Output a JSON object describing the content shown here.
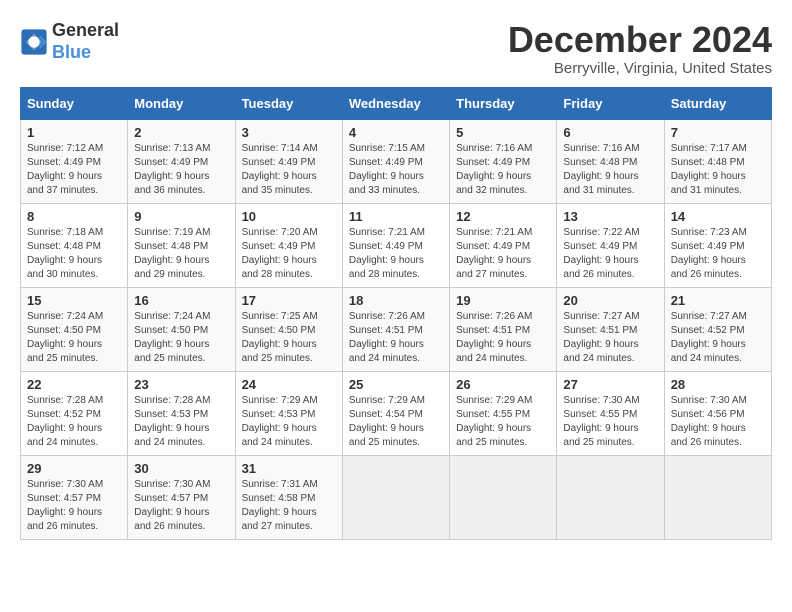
{
  "logo": {
    "text_general": "General",
    "text_blue": "Blue"
  },
  "title": "December 2024",
  "subtitle": "Berryville, Virginia, United States",
  "days_header": [
    "Sunday",
    "Monday",
    "Tuesday",
    "Wednesday",
    "Thursday",
    "Friday",
    "Saturday"
  ],
  "weeks": [
    [
      {
        "day": "1",
        "sunrise": "Sunrise: 7:12 AM",
        "sunset": "Sunset: 4:49 PM",
        "daylight": "Daylight: 9 hours and 37 minutes."
      },
      {
        "day": "2",
        "sunrise": "Sunrise: 7:13 AM",
        "sunset": "Sunset: 4:49 PM",
        "daylight": "Daylight: 9 hours and 36 minutes."
      },
      {
        "day": "3",
        "sunrise": "Sunrise: 7:14 AM",
        "sunset": "Sunset: 4:49 PM",
        "daylight": "Daylight: 9 hours and 35 minutes."
      },
      {
        "day": "4",
        "sunrise": "Sunrise: 7:15 AM",
        "sunset": "Sunset: 4:49 PM",
        "daylight": "Daylight: 9 hours and 33 minutes."
      },
      {
        "day": "5",
        "sunrise": "Sunrise: 7:16 AM",
        "sunset": "Sunset: 4:49 PM",
        "daylight": "Daylight: 9 hours and 32 minutes."
      },
      {
        "day": "6",
        "sunrise": "Sunrise: 7:16 AM",
        "sunset": "Sunset: 4:48 PM",
        "daylight": "Daylight: 9 hours and 31 minutes."
      },
      {
        "day": "7",
        "sunrise": "Sunrise: 7:17 AM",
        "sunset": "Sunset: 4:48 PM",
        "daylight": "Daylight: 9 hours and 31 minutes."
      }
    ],
    [
      {
        "day": "8",
        "sunrise": "Sunrise: 7:18 AM",
        "sunset": "Sunset: 4:48 PM",
        "daylight": "Daylight: 9 hours and 30 minutes."
      },
      {
        "day": "9",
        "sunrise": "Sunrise: 7:19 AM",
        "sunset": "Sunset: 4:48 PM",
        "daylight": "Daylight: 9 hours and 29 minutes."
      },
      {
        "day": "10",
        "sunrise": "Sunrise: 7:20 AM",
        "sunset": "Sunset: 4:49 PM",
        "daylight": "Daylight: 9 hours and 28 minutes."
      },
      {
        "day": "11",
        "sunrise": "Sunrise: 7:21 AM",
        "sunset": "Sunset: 4:49 PM",
        "daylight": "Daylight: 9 hours and 28 minutes."
      },
      {
        "day": "12",
        "sunrise": "Sunrise: 7:21 AM",
        "sunset": "Sunset: 4:49 PM",
        "daylight": "Daylight: 9 hours and 27 minutes."
      },
      {
        "day": "13",
        "sunrise": "Sunrise: 7:22 AM",
        "sunset": "Sunset: 4:49 PM",
        "daylight": "Daylight: 9 hours and 26 minutes."
      },
      {
        "day": "14",
        "sunrise": "Sunrise: 7:23 AM",
        "sunset": "Sunset: 4:49 PM",
        "daylight": "Daylight: 9 hours and 26 minutes."
      }
    ],
    [
      {
        "day": "15",
        "sunrise": "Sunrise: 7:24 AM",
        "sunset": "Sunset: 4:50 PM",
        "daylight": "Daylight: 9 hours and 25 minutes."
      },
      {
        "day": "16",
        "sunrise": "Sunrise: 7:24 AM",
        "sunset": "Sunset: 4:50 PM",
        "daylight": "Daylight: 9 hours and 25 minutes."
      },
      {
        "day": "17",
        "sunrise": "Sunrise: 7:25 AM",
        "sunset": "Sunset: 4:50 PM",
        "daylight": "Daylight: 9 hours and 25 minutes."
      },
      {
        "day": "18",
        "sunrise": "Sunrise: 7:26 AM",
        "sunset": "Sunset: 4:51 PM",
        "daylight": "Daylight: 9 hours and 24 minutes."
      },
      {
        "day": "19",
        "sunrise": "Sunrise: 7:26 AM",
        "sunset": "Sunset: 4:51 PM",
        "daylight": "Daylight: 9 hours and 24 minutes."
      },
      {
        "day": "20",
        "sunrise": "Sunrise: 7:27 AM",
        "sunset": "Sunset: 4:51 PM",
        "daylight": "Daylight: 9 hours and 24 minutes."
      },
      {
        "day": "21",
        "sunrise": "Sunrise: 7:27 AM",
        "sunset": "Sunset: 4:52 PM",
        "daylight": "Daylight: 9 hours and 24 minutes."
      }
    ],
    [
      {
        "day": "22",
        "sunrise": "Sunrise: 7:28 AM",
        "sunset": "Sunset: 4:52 PM",
        "daylight": "Daylight: 9 hours and 24 minutes."
      },
      {
        "day": "23",
        "sunrise": "Sunrise: 7:28 AM",
        "sunset": "Sunset: 4:53 PM",
        "daylight": "Daylight: 9 hours and 24 minutes."
      },
      {
        "day": "24",
        "sunrise": "Sunrise: 7:29 AM",
        "sunset": "Sunset: 4:53 PM",
        "daylight": "Daylight: 9 hours and 24 minutes."
      },
      {
        "day": "25",
        "sunrise": "Sunrise: 7:29 AM",
        "sunset": "Sunset: 4:54 PM",
        "daylight": "Daylight: 9 hours and 25 minutes."
      },
      {
        "day": "26",
        "sunrise": "Sunrise: 7:29 AM",
        "sunset": "Sunset: 4:55 PM",
        "daylight": "Daylight: 9 hours and 25 minutes."
      },
      {
        "day": "27",
        "sunrise": "Sunrise: 7:30 AM",
        "sunset": "Sunset: 4:55 PM",
        "daylight": "Daylight: 9 hours and 25 minutes."
      },
      {
        "day": "28",
        "sunrise": "Sunrise: 7:30 AM",
        "sunset": "Sunset: 4:56 PM",
        "daylight": "Daylight: 9 hours and 26 minutes."
      }
    ],
    [
      {
        "day": "29",
        "sunrise": "Sunrise: 7:30 AM",
        "sunset": "Sunset: 4:57 PM",
        "daylight": "Daylight: 9 hours and 26 minutes."
      },
      {
        "day": "30",
        "sunrise": "Sunrise: 7:30 AM",
        "sunset": "Sunset: 4:57 PM",
        "daylight": "Daylight: 9 hours and 26 minutes."
      },
      {
        "day": "31",
        "sunrise": "Sunrise: 7:31 AM",
        "sunset": "Sunset: 4:58 PM",
        "daylight": "Daylight: 9 hours and 27 minutes."
      },
      null,
      null,
      null,
      null
    ]
  ]
}
